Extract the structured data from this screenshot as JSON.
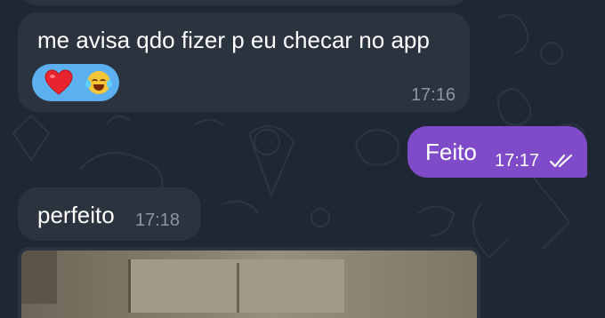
{
  "chat": {
    "messages": [
      {
        "direction": "incoming",
        "text": "me avisa qdo fizer p eu checar no app",
        "time": "17:16",
        "reactions": [
          {
            "icon": "red-heart-icon"
          },
          {
            "icon": "laughing-tears-emoji-icon"
          }
        ]
      },
      {
        "direction": "outgoing",
        "text": "Feito",
        "time": "17:17",
        "status_icon": "double-check-read-icon"
      },
      {
        "direction": "incoming",
        "text": "perfeito",
        "time": "17:18"
      },
      {
        "direction": "incoming",
        "type": "photo"
      }
    ]
  },
  "colors": {
    "background": "#1e2733",
    "incoming_bubble": "#2b333f",
    "outgoing_bubble": "#7f4bc9",
    "reaction_pill": "#5cb0f0",
    "incoming_time": "#8c96a2"
  }
}
